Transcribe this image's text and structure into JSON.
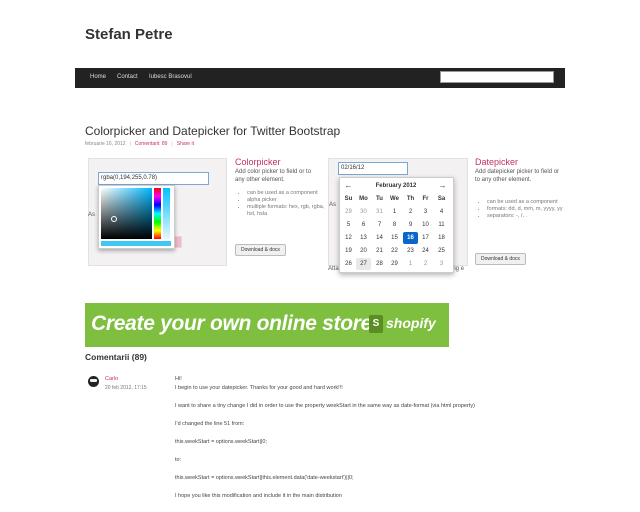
{
  "site": {
    "title": "Stefan Petre"
  },
  "nav": {
    "items": [
      "Home",
      "Contact",
      "Iubesc Brasovul"
    ],
    "search_value": ""
  },
  "post": {
    "title": "Colorpicker and Datepicker for Twitter Bootstrap",
    "date": "februarie 16, 2012",
    "comments_link": "Comentarii: 89",
    "share_link": "Share it"
  },
  "colorpicker": {
    "input_value": "rgba(0,194,255,0.78)",
    "title": "Colorpicker",
    "desc": "Add color picker to field or to any other element.",
    "features": [
      "can be used as a component",
      "alpha picker",
      "multiple formats: hex, rgb, rgba, hsl, hsla"
    ],
    "download_label": "Download & docs",
    "partial_label": "As"
  },
  "datepicker": {
    "input_value": "02/16/12",
    "month_label": "February 2012",
    "prev_icon": "arrow-left-icon",
    "next_icon": "arrow-right-icon",
    "weekdays": [
      "Su",
      "Mo",
      "Tu",
      "We",
      "Th",
      "Fr",
      "Sa"
    ],
    "weeks": [
      [
        "29",
        "30",
        "31",
        "1",
        "2",
        "3",
        "4"
      ],
      [
        "5",
        "6",
        "7",
        "8",
        "9",
        "10",
        "11"
      ],
      [
        "12",
        "13",
        "14",
        "15",
        "16",
        "17",
        "18"
      ],
      [
        "19",
        "20",
        "21",
        "22",
        "23",
        "24",
        "25"
      ],
      [
        "26",
        "27",
        "28",
        "29",
        "1",
        "2",
        "3"
      ]
    ],
    "selected_day": "16",
    "title": "Datepicker",
    "desc": "Add datepicker picker to field or to any other element.",
    "features": [
      "can be used as a component",
      "formats: dd, d, mm, m, yyyy, yy",
      "separators: -, /, ."
    ],
    "download_label": "Download & docs",
    "partial_label_left": "As",
    "partial_label_bottom": "Atta",
    "partial_label_bottom_right": "ing e"
  },
  "banner": {
    "text": "Create your own online store",
    "brand": "shopify"
  },
  "comments": {
    "title": "Comentarii (89)",
    "first": {
      "author": "Carlo",
      "date": "20 feb 2012, 17:15",
      "lines": [
        "Hi!",
        "I begin to use your datepicker. Thanks for your good and hard work!!!",
        "I want to share a tiny change I did in order to use the property weekStart in the same way as date-format (via html property)",
        "I'd changed the line 51 from:",
        "this.weekStart = options.weekStart||0;",
        "to:",
        "this.weekStart = options.weekStart||this.element.data('date-weekstart')||0;",
        "I hope you like this modification and include it in the main distribution"
      ]
    }
  },
  "colors": {
    "accent": "#c3325f",
    "nav_bg": "#222222",
    "banner_bg": "#7fbf3f",
    "selected_day": "#0a67c9"
  }
}
